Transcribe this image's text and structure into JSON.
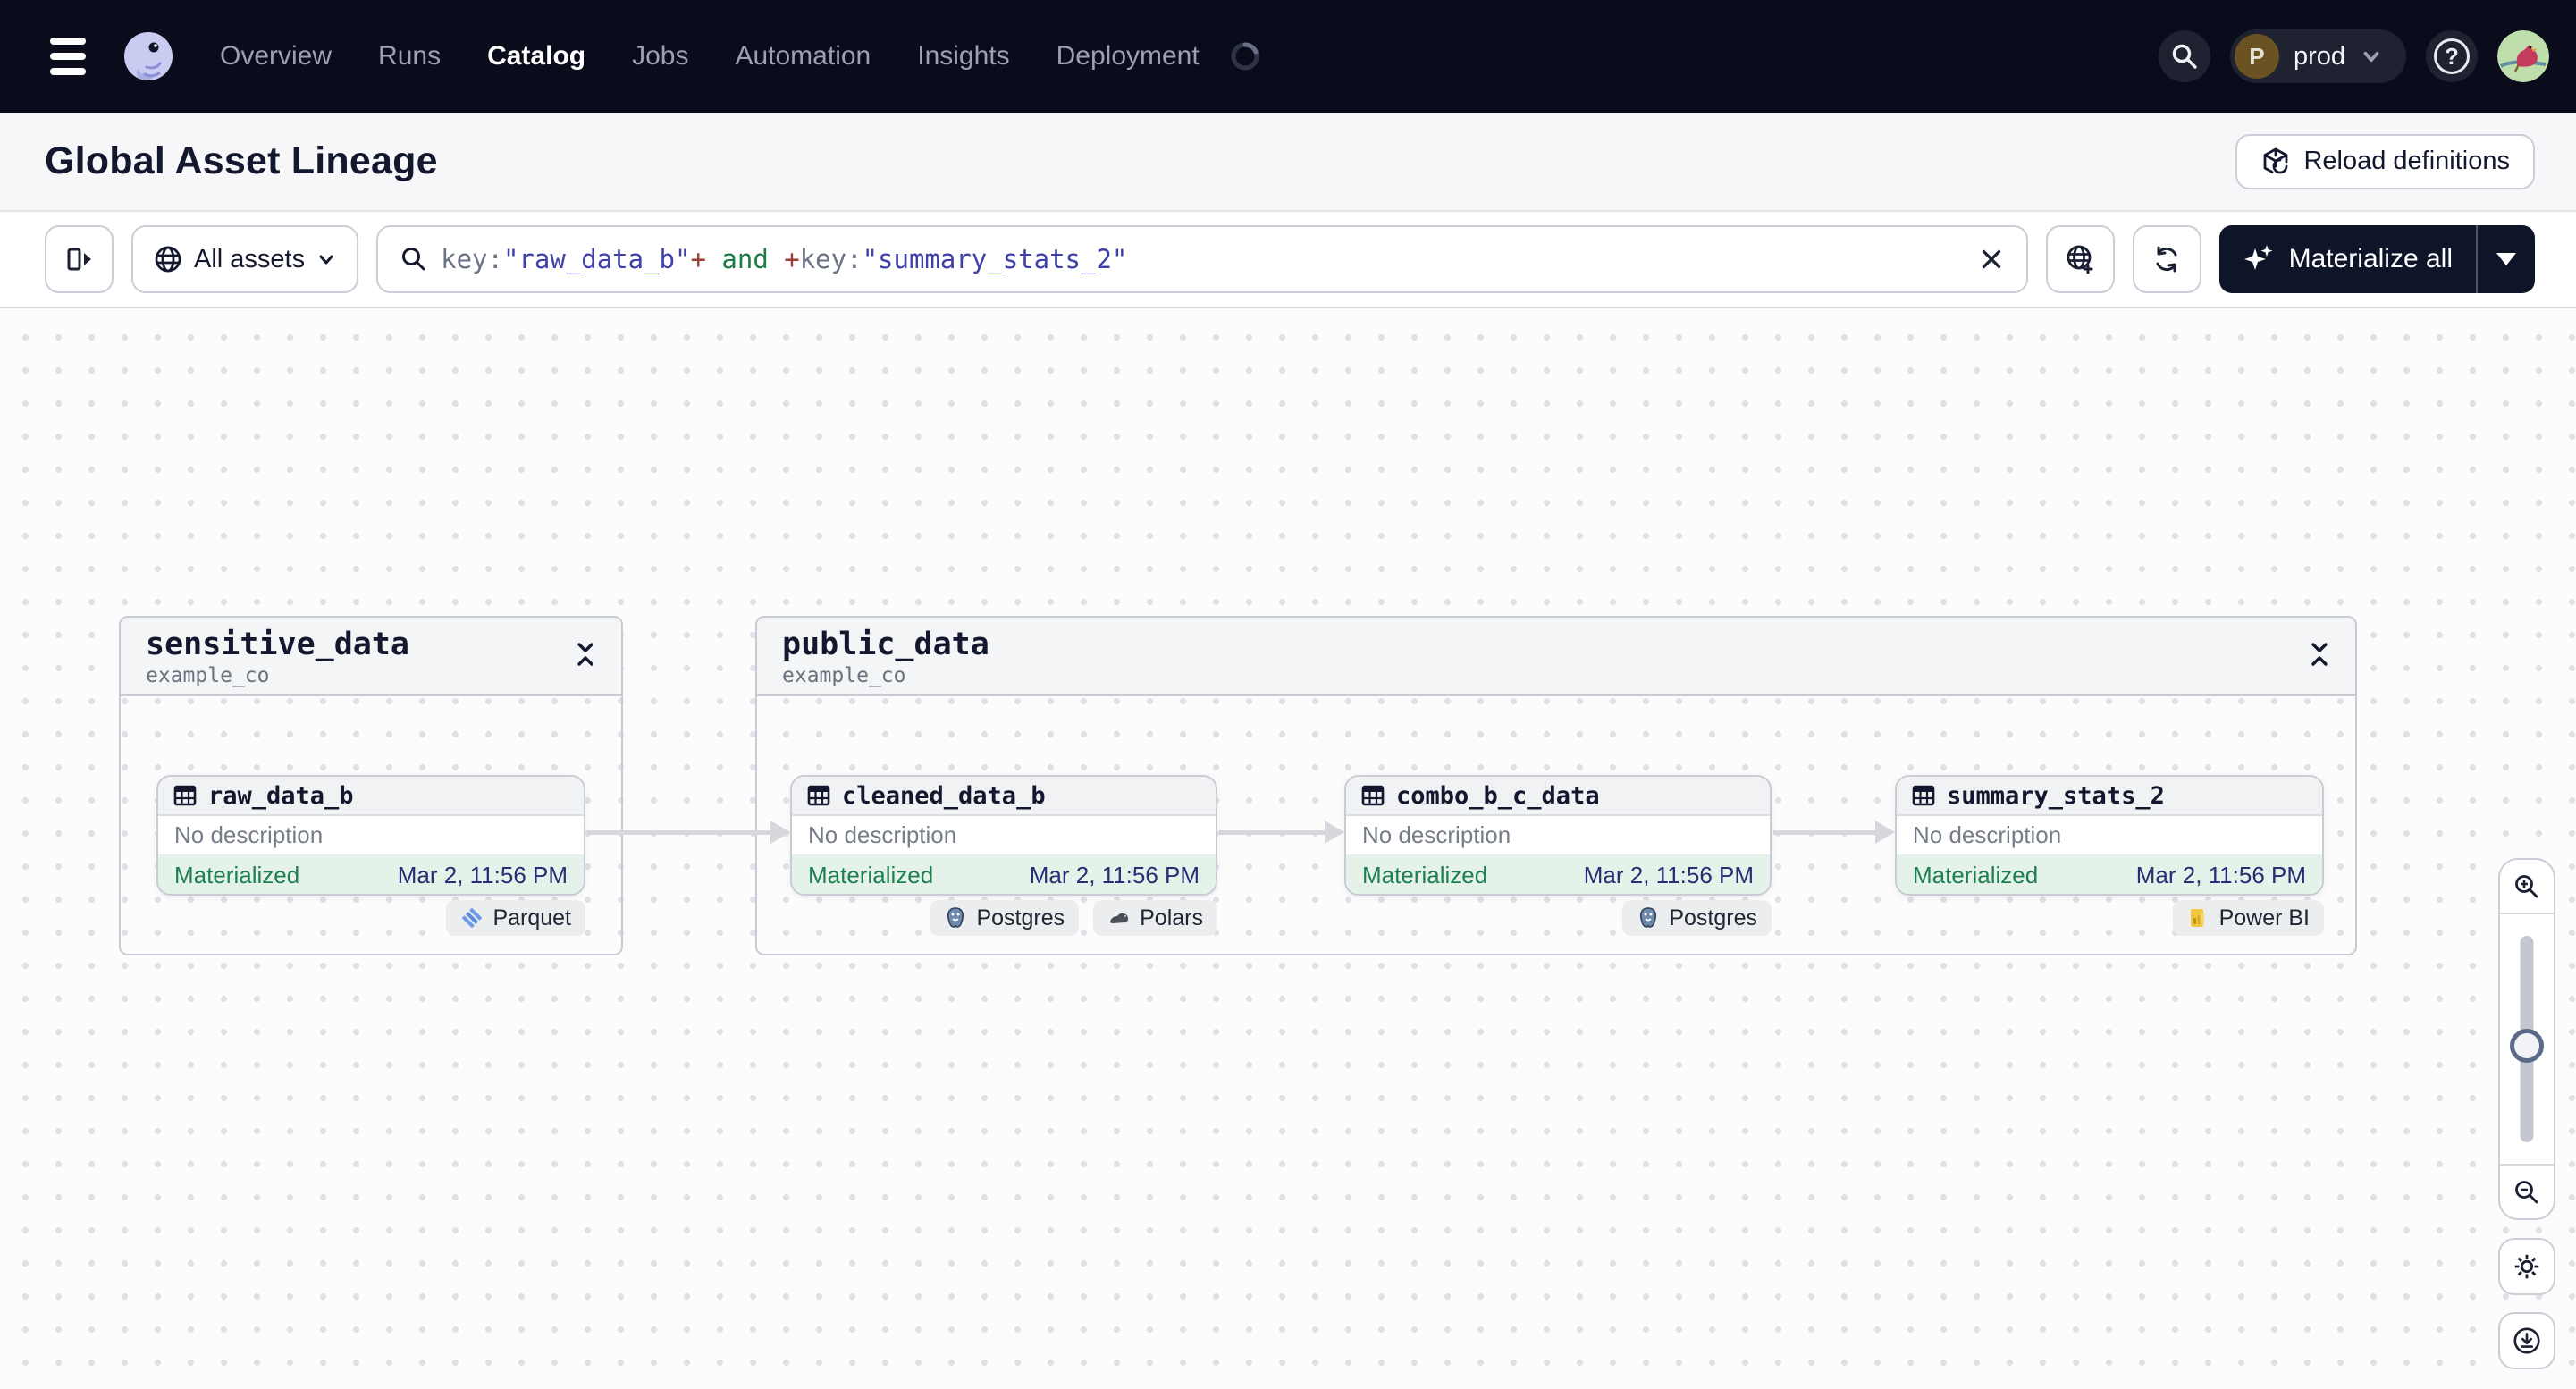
{
  "nav": {
    "items": [
      {
        "label": "Overview"
      },
      {
        "label": "Runs"
      },
      {
        "label": "Catalog"
      },
      {
        "label": "Jobs"
      },
      {
        "label": "Automation"
      },
      {
        "label": "Insights"
      },
      {
        "label": "Deployment"
      }
    ],
    "active_item": "Catalog",
    "env": {
      "label": "prod",
      "avatar_letter": "P"
    }
  },
  "header": {
    "title": "Global Asset Lineage",
    "reload_label": "Reload definitions"
  },
  "toolbar": {
    "assets_filter_label": "All assets",
    "materialize_label": "Materialize all",
    "query_tokens": {
      "t0": "key:",
      "t1": "\"raw_data_b\"",
      "t2": "+",
      "t3": " and ",
      "t4": "+",
      "t5": "key:",
      "t6": "\"summary_stats_2\""
    }
  },
  "graph": {
    "groups": [
      {
        "name": "sensitive_data",
        "repo": "example_co"
      },
      {
        "name": "public_data",
        "repo": "example_co"
      }
    ],
    "assets": [
      {
        "name": "raw_data_b",
        "description": "No description",
        "status": "Materialized",
        "timestamp": "Mar 2, 11:56 PM",
        "tags": [
          "Parquet"
        ]
      },
      {
        "name": "cleaned_data_b",
        "description": "No description",
        "status": "Materialized",
        "timestamp": "Mar 2, 11:56 PM",
        "tags": [
          "Postgres",
          "Polars"
        ]
      },
      {
        "name": "combo_b_c_data",
        "description": "No description",
        "status": "Materialized",
        "timestamp": "Mar 2, 11:56 PM",
        "tags": [
          "Postgres"
        ]
      },
      {
        "name": "summary_stats_2",
        "description": "No description",
        "status": "Materialized",
        "timestamp": "Mar 2, 11:56 PM",
        "tags": [
          "Power BI"
        ]
      }
    ]
  },
  "colors": {
    "topnav_bg": "#0A0C1B",
    "nav_inactive": "#9BA0B2",
    "nav_active": "#FFFFFF",
    "page_bg": "#FCFCFD",
    "accent_dark": "#0E1528",
    "materialized_bg": "#E4F2EA",
    "materialized_text": "#1E7F4F",
    "timestamp_text": "#262F73",
    "query_key": "#6A7384",
    "query_string": "#3E41A8",
    "query_operator": "#9A3B32",
    "query_bool": "#1E7A44",
    "edge": "#D6D8DD"
  }
}
